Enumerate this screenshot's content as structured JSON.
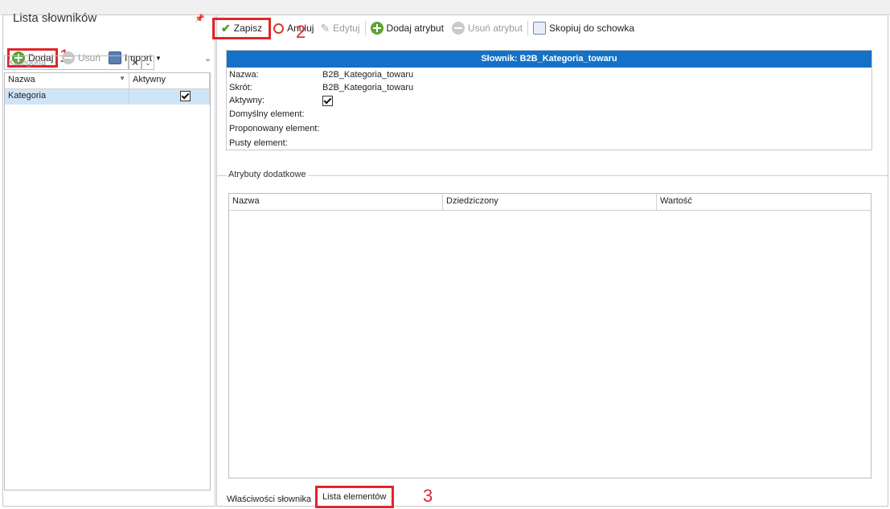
{
  "left": {
    "title": "Lista słowników",
    "toolbar": {
      "add_label": "Dodaj",
      "delete_label": "Usuń",
      "import_label": "Import"
    },
    "filter_placeholder": "Kategoria",
    "grid": {
      "columns": [
        "Nazwa",
        "Aktywny"
      ],
      "rows": [
        {
          "name": "Kategoria",
          "active": true
        }
      ]
    }
  },
  "toolbar": {
    "save_label": "Zapisz",
    "cancel_label": "Anuluj",
    "edit_label": "Edytuj",
    "add_attribute_label": "Dodaj atrybut",
    "remove_attribute_label": "Usuń atrybut",
    "copy_label": "Skopiuj do schowka"
  },
  "dictionary": {
    "header": "Słownik: B2B_Kategoria_towaru",
    "fields": [
      {
        "label": "Nazwa:",
        "value": "B2B_Kategoria_towaru"
      },
      {
        "label": "Skrót:",
        "value": "B2B_Kategoria_towaru"
      },
      {
        "label": "Aktywny:",
        "value": ""
      },
      {
        "label": "Domyślny element:",
        "value": ""
      },
      {
        "label": "Proponowany element:",
        "value": ""
      },
      {
        "label": "Pusty element:",
        "value": ""
      }
    ],
    "active": true
  },
  "attributes": {
    "title": "Atrybuty dodatkowe",
    "columns": [
      "Nazwa",
      "Dziedziczony",
      "Wartość"
    ]
  },
  "tabs": {
    "properties": "Właściwości słownika",
    "elements": "Lista elementów"
  },
  "markers": {
    "one": "1",
    "two": "2",
    "three": "3"
  },
  "colors": {
    "header_blue": "#1372c8",
    "highlight_red": "#e0262a",
    "selected_row": "#cfe4f7",
    "add_green": "#5aa433"
  }
}
